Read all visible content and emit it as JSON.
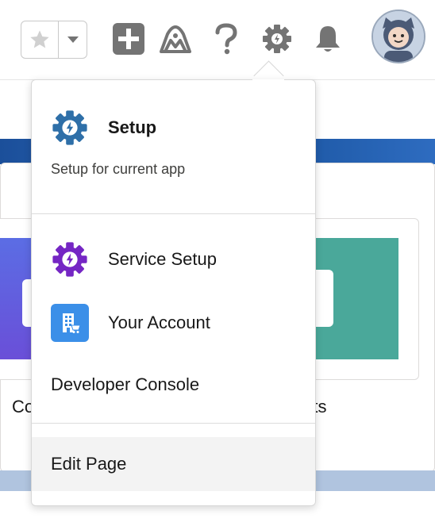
{
  "header": {
    "favorites_star_icon": "star-icon",
    "favorites_menu_icon": "chevron-down-icon",
    "global_actions_icon": "plus-icon",
    "guidance_icon": "trailhead-icon",
    "help_icon": "question-icon",
    "setup_icon": "gear-icon",
    "notifications_icon": "bell-icon",
    "avatar_icon": "astro-avatar"
  },
  "background": {
    "card_left_label": "Co",
    "card_right_label": "rts"
  },
  "setup_menu": {
    "setup": {
      "title": "Setup",
      "subtitle": "Setup for current app",
      "icon": "setup-gear-icon"
    },
    "items": [
      {
        "label": "Service Setup",
        "icon": "service-setup-gear-icon"
      },
      {
        "label": "Your Account",
        "icon": "account-building-icon"
      },
      {
        "label": "Developer Console",
        "icon": ""
      },
      {
        "label": "Edit Page",
        "icon": ""
      }
    ]
  },
  "colors": {
    "setup_gear": "#2e6fa8",
    "service_gear": "#7526c4",
    "account_tile": "#3b8fe8",
    "header_icon": "#747474",
    "hover_row": "#f3f3f3"
  }
}
